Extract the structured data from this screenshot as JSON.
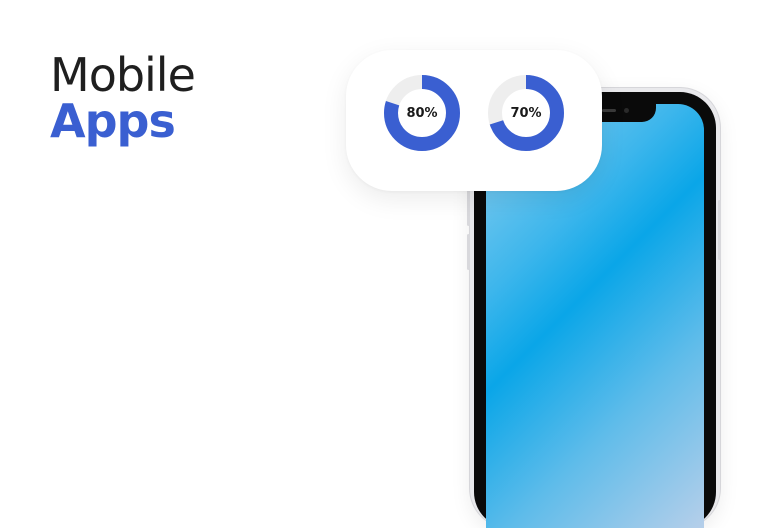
{
  "headline": {
    "line1": "Mobile",
    "line2": "Apps"
  },
  "colors": {
    "accent": "#3a5fd1",
    "donut_track": "#eeeeee",
    "screen_gradient": [
      "#8fd0f0",
      "#0aa6e8",
      "#b6cfea"
    ]
  },
  "stats": [
    {
      "label": "80%",
      "value": 0.8
    },
    {
      "label": "70%",
      "value": 0.7
    }
  ]
}
